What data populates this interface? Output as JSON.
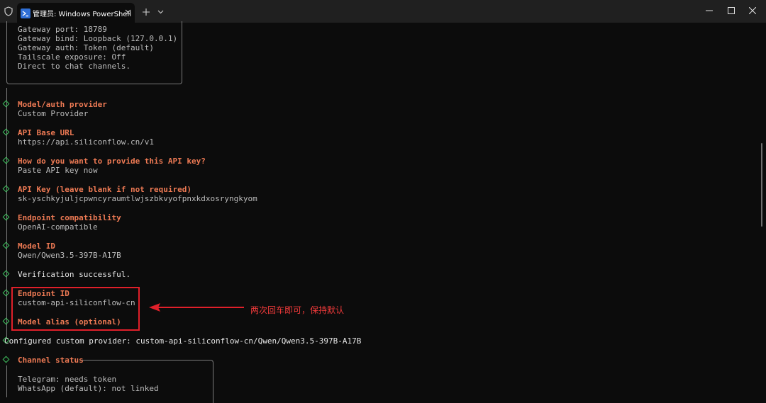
{
  "window": {
    "tab_title": "管理员: Windows PowerShell",
    "icons": {
      "shield": "shield-icon",
      "tab": "powershell-icon",
      "tab_close": "close-icon",
      "new_tab": "plus-icon",
      "dropdown": "chevron-down-icon",
      "minimize": "minimize-icon",
      "maximize": "maximize-icon",
      "close": "close-icon"
    }
  },
  "terminal": {
    "gateway_lines": [
      "Gateway port: 18789",
      "Gateway bind: Loopback (127.0.0.1)",
      "Gateway auth: Token (default)",
      "Tailscale exposure: Off",
      "Direct to chat channels."
    ],
    "provider": {
      "prompt": "Model/auth provider",
      "answer": "Custom Provider"
    },
    "base_url": {
      "prompt": "API Base URL",
      "answer": "https://api.siliconflow.cn/v1"
    },
    "key_method": {
      "prompt": "How do you want to provide this API key?",
      "answer": "Paste API key now"
    },
    "api_key": {
      "prompt": "API Key (leave blank if not required)",
      "answer": "sk-yschkyjuljcpwncyraumtlwjszbkvyofpnxkdxosryngkyom"
    },
    "compat": {
      "prompt": "Endpoint compatibility",
      "answer": "OpenAI-compatible"
    },
    "model_id": {
      "prompt": "Model ID",
      "answer": "Qwen/Qwen3.5-397B-A17B"
    },
    "verification": "Verification successful.",
    "endpoint_id": {
      "prompt": "Endpoint ID",
      "answer": "custom-api-siliconflow-cn"
    },
    "model_alias": {
      "prompt": "Model alias (optional)"
    },
    "configured": "Configured custom provider: custom-api-siliconflow-cn/Qwen/Qwen3.5-397B-A17B",
    "channel_status": {
      "title": "Channel status",
      "lines": [
        "Telegram: needs token",
        "WhatsApp (default): not linked"
      ]
    }
  },
  "annotation": {
    "text": "两次回车即可，保持默认"
  },
  "colors": {
    "background": "#0c0c0c",
    "prompt": "#ee7a54",
    "answer": "#bdbdbd",
    "marker": "#3fbf5e",
    "highlight": "#e0202a"
  }
}
